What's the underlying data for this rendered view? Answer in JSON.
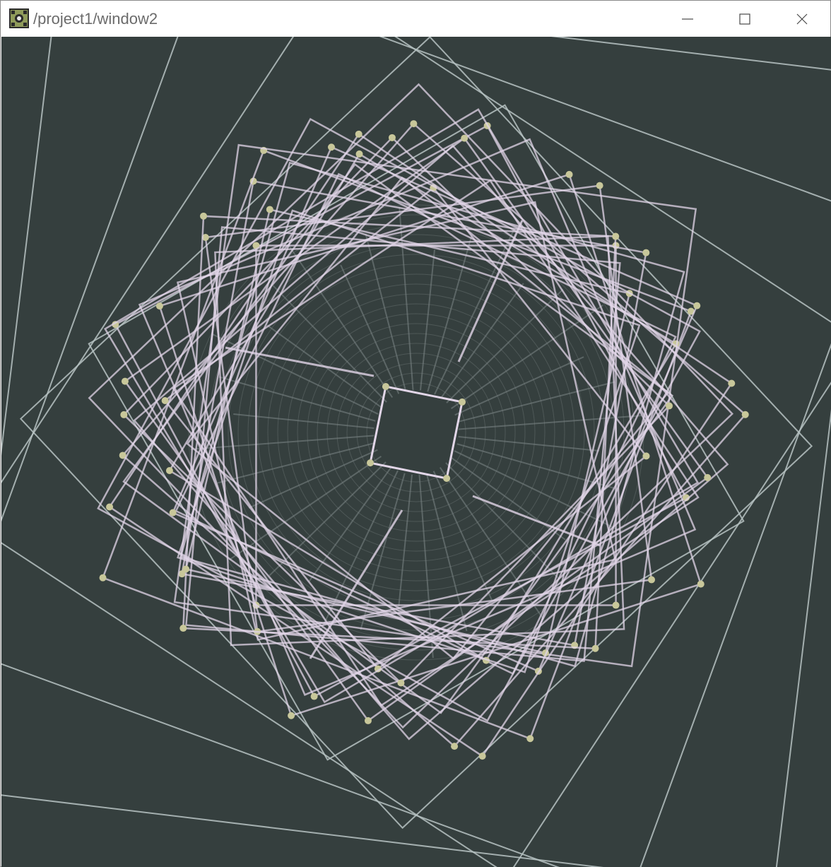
{
  "window": {
    "title": "/project1/window2",
    "app_icon": "touchdesigner-app-icon",
    "controls": [
      "minimize-icon",
      "maximize-icon",
      "close-icon"
    ]
  },
  "canvas": {
    "content": "generative-art-render",
    "colors": {
      "background": "#353f3e",
      "frame_lines": "#b7c3c3",
      "strokes": "#e2d6e8",
      "nodes": "#c8c79a",
      "texture": "#7d8787"
    }
  }
}
